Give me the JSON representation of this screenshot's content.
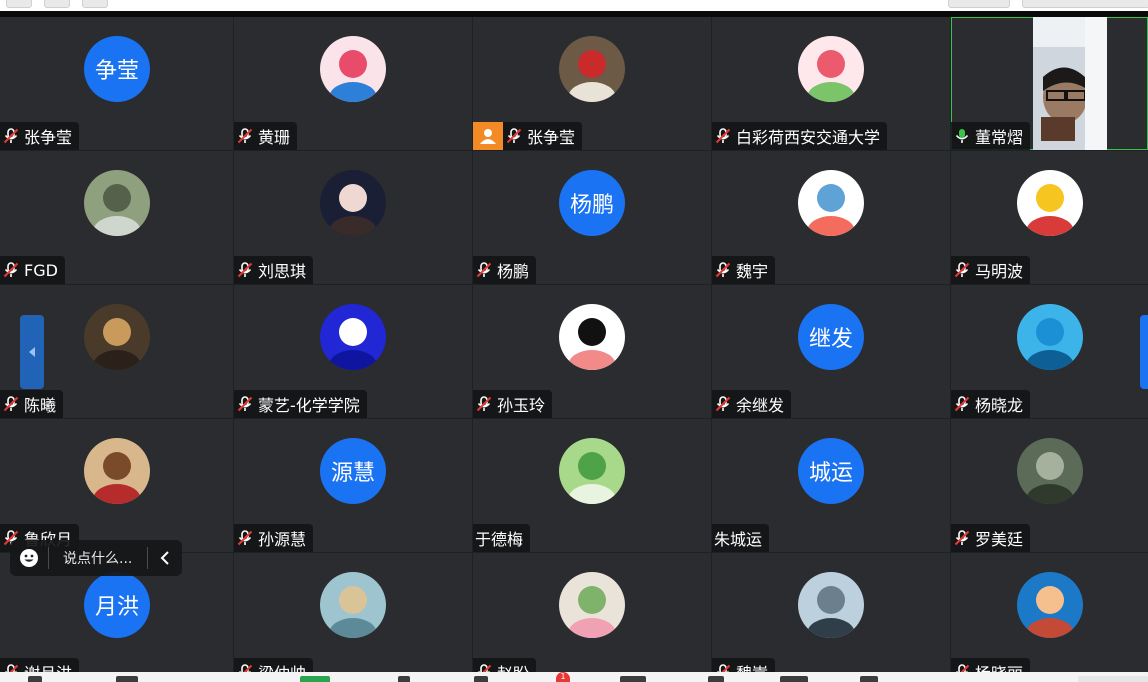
{
  "participants": [
    {
      "name": "张争莹",
      "avatar_text": "争莹",
      "mic": "muted",
      "avatar_kind": "text"
    },
    {
      "name": "黄珊",
      "mic": "muted",
      "avatar_kind": "photo",
      "avatar_desc": "anime-girl-icon",
      "colors": [
        "#fbe3ea",
        "#e94b6b",
        "#2d7fd8"
      ]
    },
    {
      "name": "张争莹",
      "mic": "muted",
      "avatar_kind": "photo",
      "host": true,
      "avatar_desc": "dog-photo-icon",
      "colors": [
        "#6d5a46",
        "#c92a2a",
        "#e9e2d6"
      ]
    },
    {
      "name": "白彩荷西安交通大学",
      "mic": "muted",
      "avatar_kind": "photo",
      "avatar_desc": "cartoon-pink-icon",
      "colors": [
        "#ffe8ec",
        "#ec5a6d",
        "#7cc46a"
      ]
    },
    {
      "name": "董常熠",
      "mic": "active",
      "avatar_kind": "video",
      "avatar_desc": "camera-feed"
    },
    {
      "name": "FGD",
      "mic": "muted",
      "avatar_kind": "photo",
      "avatar_desc": "street-photo-icon",
      "colors": [
        "#8fa07f",
        "#56614b",
        "#cfd6cd"
      ]
    },
    {
      "name": "刘思琪",
      "mic": "muted",
      "avatar_kind": "photo",
      "avatar_desc": "girl-portrait-icon",
      "colors": [
        "#1a1f35",
        "#f0d8d2",
        "#3a2b2b"
      ]
    },
    {
      "name": "杨鹏",
      "avatar_text": "杨鹏",
      "mic": "muted",
      "avatar_kind": "text"
    },
    {
      "name": "魏宇",
      "mic": "muted",
      "avatar_kind": "photo",
      "avatar_desc": "panda-cartoon-icon",
      "colors": [
        "#ffffff",
        "#5fa3d6",
        "#f36c5d"
      ]
    },
    {
      "name": "马明波",
      "mic": "muted",
      "avatar_kind": "photo",
      "avatar_desc": "winnie-pooh-icon",
      "colors": [
        "#ffffff",
        "#f7c520",
        "#d93b3b"
      ]
    },
    {
      "name": "陈曦",
      "mic": "muted",
      "avatar_kind": "photo",
      "avatar_desc": "boy-eating-icon",
      "colors": [
        "#4a3a2a",
        "#c89a5c",
        "#2b211a"
      ]
    },
    {
      "name": "蒙艺-化学学院",
      "mic": "muted",
      "avatar_kind": "photo",
      "avatar_desc": "blue-sketch-icon",
      "colors": [
        "#2227d6",
        "#ffffff",
        "#1015a0"
      ]
    },
    {
      "name": "孙玉玲",
      "mic": "muted",
      "avatar_kind": "photo",
      "avatar_desc": "cartoon-girl-icon",
      "colors": [
        "#ffffff",
        "#111111",
        "#f28a8a"
      ]
    },
    {
      "name": "余继发",
      "avatar_text": "继发",
      "mic": "muted",
      "avatar_kind": "text"
    },
    {
      "name": "杨晓龙",
      "mic": "muted",
      "avatar_kind": "photo",
      "avatar_desc": "sky-lamp-icon",
      "colors": [
        "#3cb4ea",
        "#1c90d5",
        "#0d5f96"
      ]
    },
    {
      "name": "鲁欣月",
      "mic": "muted",
      "avatar_kind": "photo",
      "avatar_desc": "hermione-icon",
      "colors": [
        "#d9b78c",
        "#7a4b2b",
        "#b62c2c"
      ]
    },
    {
      "name": "孙源慧",
      "avatar_text": "源慧",
      "mic": "muted",
      "avatar_kind": "text"
    },
    {
      "name": "于德梅",
      "mic": "none",
      "avatar_kind": "photo",
      "avatar_desc": "leaf-photo-icon",
      "colors": [
        "#a8d98b",
        "#4ea24a",
        "#e8f4e0"
      ]
    },
    {
      "name": "朱城运",
      "avatar_text": "城运",
      "mic": "none",
      "avatar_kind": "text"
    },
    {
      "name": "罗美廷",
      "mic": "muted",
      "avatar_kind": "photo",
      "avatar_desc": "garden-photo-icon",
      "colors": [
        "#5c6a58",
        "#a6b19d",
        "#2f3a2c"
      ]
    },
    {
      "name": "谢月洪",
      "avatar_text": "月洪",
      "mic": "muted",
      "avatar_kind": "text"
    },
    {
      "name": "梁仲帅",
      "mic": "muted",
      "avatar_kind": "photo",
      "avatar_desc": "sea-photo-icon",
      "colors": [
        "#9ec4cf",
        "#d8c497",
        "#5d8a99"
      ]
    },
    {
      "name": "赵盼",
      "mic": "muted",
      "avatar_kind": "photo",
      "avatar_desc": "girl-hat-icon",
      "colors": [
        "#eae3da",
        "#7fb36b",
        "#f0a1b4"
      ]
    },
    {
      "name": "魏嵩",
      "mic": "muted",
      "avatar_kind": "photo",
      "avatar_desc": "lake-photo-icon",
      "colors": [
        "#bcd0de",
        "#6b7f8d",
        "#2f3e49"
      ]
    },
    {
      "name": "杨晓丽",
      "mic": "muted",
      "avatar_kind": "photo",
      "avatar_desc": "cartoon-boy-icon",
      "colors": [
        "#1c79c8",
        "#f5c08e",
        "#c24a36"
      ]
    }
  ],
  "chat": {
    "placeholder": "说点什么..."
  },
  "notification_badge": "1"
}
